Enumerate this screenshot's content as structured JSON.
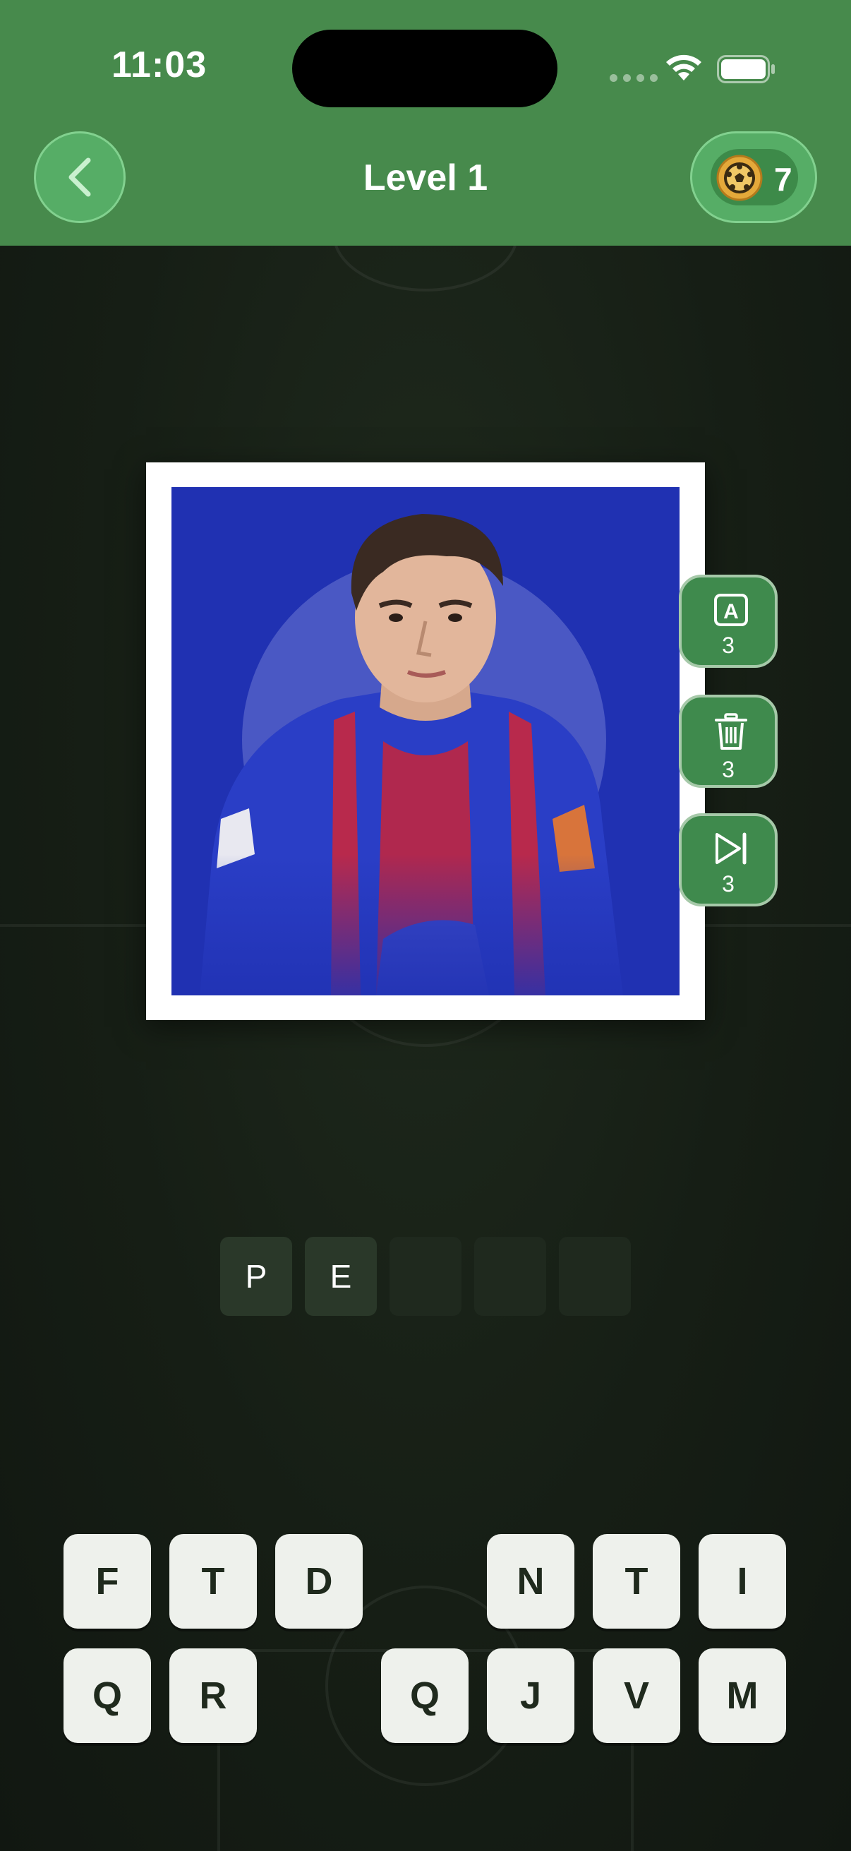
{
  "status_bar": {
    "time": "11:03"
  },
  "header": {
    "back_icon": "chevron-left-icon",
    "title": "Level 1",
    "coins": "7",
    "coin_icon": "soccer-ball-coin-icon"
  },
  "colors": {
    "header_bg": "#478a4c",
    "button_green": "#56ad66",
    "hint_green": "#3f8a4d",
    "photo_bg": "#2031b2",
    "key_bg": "#eef1ec",
    "page_bg": "#151c14"
  },
  "photo": {
    "subject": "player-photo"
  },
  "hints": [
    {
      "icon": "reveal-letter-icon",
      "glyph": "A",
      "count": "3"
    },
    {
      "icon": "trash-icon",
      "count": "3"
    },
    {
      "icon": "skip-icon",
      "count": "3"
    }
  ],
  "answer": {
    "slots": [
      "P",
      "E",
      "",
      "",
      ""
    ]
  },
  "keyboard": {
    "row1": [
      "F",
      "T",
      "D",
      "",
      "N",
      "T",
      "I"
    ],
    "row2": [
      "Q",
      "R",
      "",
      "Q",
      "J",
      "V",
      "M"
    ]
  }
}
